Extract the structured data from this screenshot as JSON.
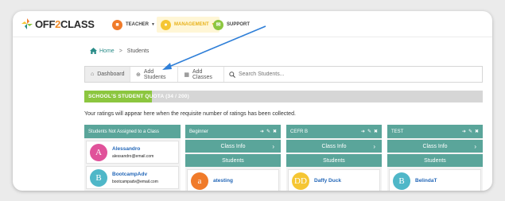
{
  "brand": {
    "logo_text_pre": "OFF",
    "logo_text_two": "2",
    "logo_text_post": "CLASS"
  },
  "nav": {
    "teacher": "TEACHER",
    "management": "MANAGEMENT",
    "support": "SUPPORT"
  },
  "breadcrumb": {
    "home": "Home",
    "separator": ">",
    "current": "Students"
  },
  "toolbar": {
    "dashboard": "Dashboard",
    "add_students": "Add Students",
    "add_classes": "Add Classes",
    "search_placeholder": "Search Students..."
  },
  "quota": {
    "label": "SCHOOL'S STUDENT QUOTA (34 / 200)",
    "used": 34,
    "total": 200
  },
  "ratings_notice": "Your ratings will appear here when the requisite number of ratings has been collected.",
  "unassigned": {
    "title": "Students Not Assigned to a Class",
    "students": [
      {
        "initial": "A",
        "name": "Alessandro",
        "email": "alessandro@email.com",
        "color": "#e0529a"
      },
      {
        "initial": "B",
        "name": "BootcampAdv",
        "email": "bootcampadv@email.com",
        "color": "#4fb7c8"
      }
    ]
  },
  "classes": [
    {
      "name": "Beginner",
      "class_info": "Class Info",
      "students_label": "Students",
      "student": {
        "initial": "a",
        "name": "atesting",
        "color": "#f07b2a"
      }
    },
    {
      "name": "CEFR B",
      "class_info": "Class Info",
      "students_label": "Students",
      "student": {
        "initial": "DD",
        "name": "Daffy Duck",
        "color": "#f5c633"
      }
    },
    {
      "name": "TEST",
      "class_info": "Class Info",
      "students_label": "Students",
      "student": {
        "initial": "B",
        "name": "BelindaT",
        "color": "#4fb7c8"
      }
    }
  ],
  "colors": {
    "teal": "#5aa59a",
    "green": "#8cc63f",
    "orange": "#f07b2a",
    "yellow": "#f5c633",
    "arrow": "#2f7fd8"
  }
}
